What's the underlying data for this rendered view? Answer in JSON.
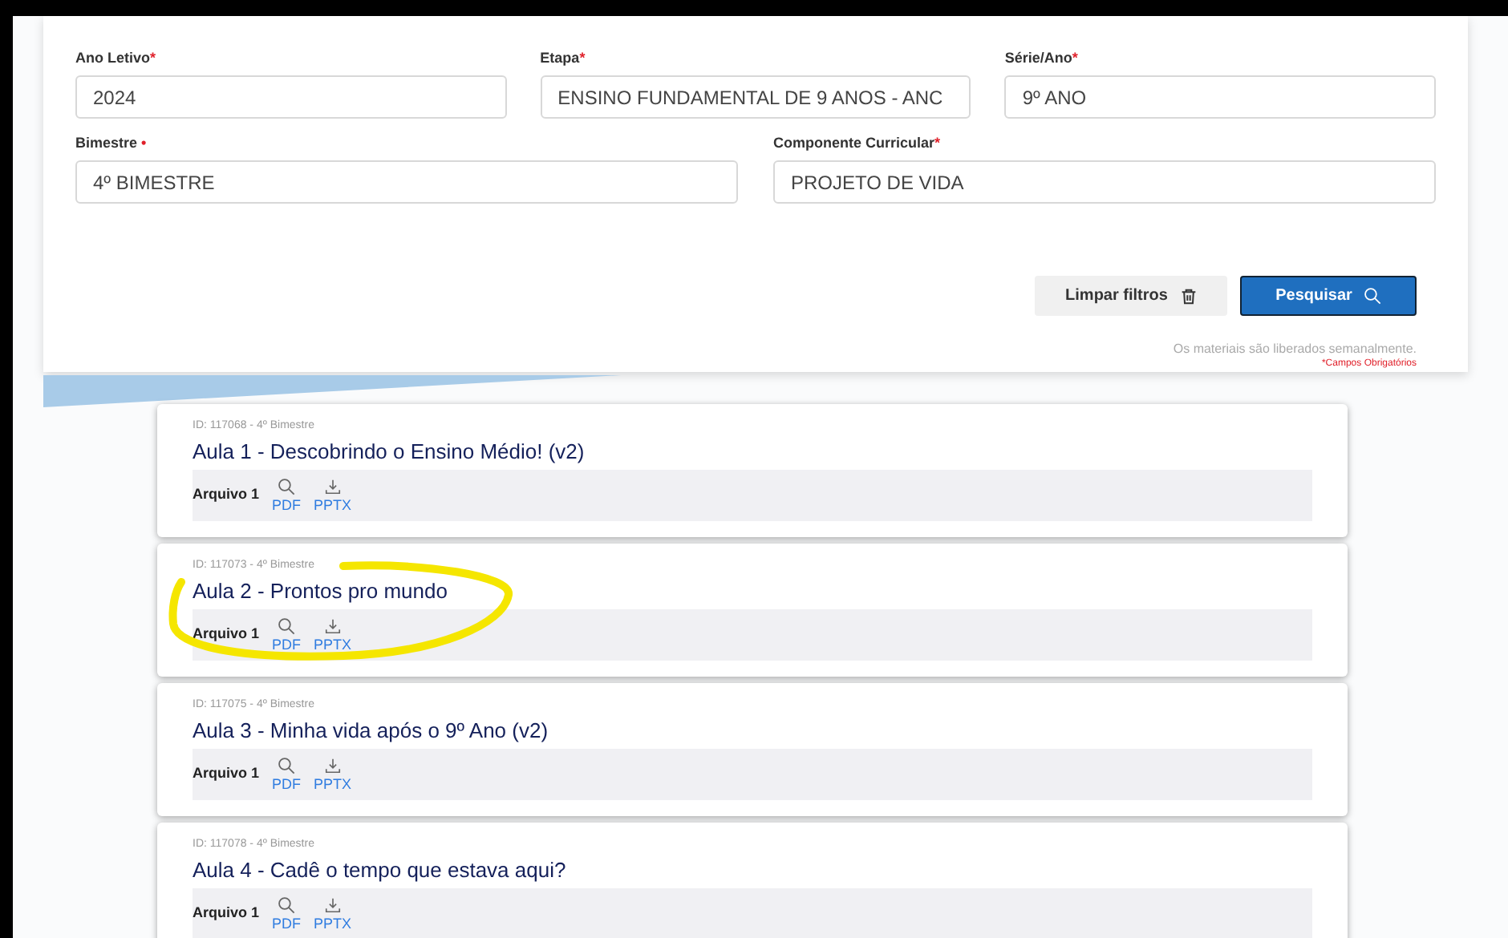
{
  "filters": {
    "row_1": [
      {
        "label": "Ano Letivo",
        "mark": "*",
        "value": "2024"
      },
      {
        "label": "Etapa",
        "mark": "*",
        "value": "ENSINO FUNDAMENTAL DE 9 ANOS - ANC"
      },
      {
        "label": "Série/Ano",
        "mark": "*",
        "value": "9º ANO"
      }
    ],
    "row_2": [
      {
        "label": "Bimestre",
        "mark": " •",
        "value": "4º BIMESTRE"
      },
      {
        "label": "Componente Curricular",
        "mark": "*",
        "value": "PROJETO DE VIDA"
      }
    ],
    "clear_button": "Limpar filtros",
    "search_button": "Pesquisar",
    "note": "Os materiais são liberados semanalmente.",
    "required_note": "*Campos Obrigatórios"
  },
  "lessons": [
    {
      "meta": "ID: 117068 - 4º Bimestre",
      "title": "Aula 1 - Descobrindo o Ensino Médio! (v2)",
      "file_label": "Arquivo 1",
      "view_link": "PDF",
      "download_link": "PPTX",
      "highlighted": false
    },
    {
      "meta": "ID: 117073 - 4º Bimestre",
      "title": "Aula 2 - Prontos pro mundo",
      "file_label": "Arquivo 1",
      "view_link": "PDF",
      "download_link": "PPTX",
      "highlighted": true
    },
    {
      "meta": "ID: 117075 - 4º Bimestre",
      "title": "Aula 3 - Minha vida após o 9º Ano (v2)",
      "file_label": "Arquivo 1",
      "view_link": "PDF",
      "download_link": "PPTX",
      "highlighted": false
    },
    {
      "meta": "ID: 117078 - 4º Bimestre",
      "title": "Aula 4 - Cadê o tempo que estava aqui?",
      "file_label": "Arquivo 1",
      "view_link": "PDF",
      "download_link": "PPTX",
      "highlighted": false
    }
  ]
}
